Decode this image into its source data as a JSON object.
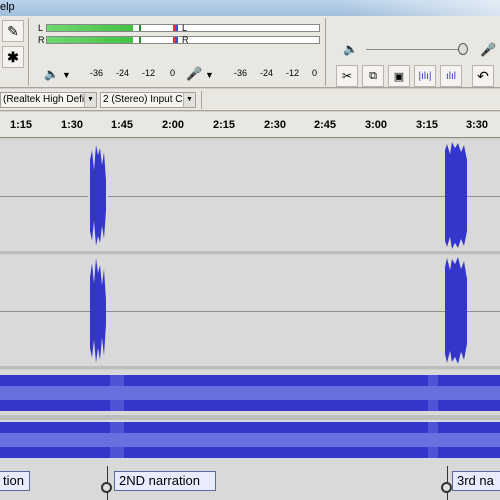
{
  "menu": {
    "partial_help": "elp"
  },
  "colors": {
    "waveform": "#3436cb",
    "waveform_light": "#6a6fe0",
    "track_bg": "#d9d9d9",
    "meter_green": "#44c244"
  },
  "meters": {
    "play_ticks": [
      "-36",
      "-24",
      "-12",
      "0"
    ],
    "rec_ticks": [
      "-36",
      "-24",
      "-12",
      "0"
    ],
    "left_channel": "L",
    "right_channel": "R"
  },
  "toolbar_icons": {
    "pencil": "pencil-icon",
    "multi": "multi-tool-icon",
    "speaker": "speaker-icon",
    "mic": "microphone-icon",
    "trim": "trim-icon",
    "silence": "silence-icon",
    "undo": "undo-icon"
  },
  "device": {
    "output_device": "(Realtek High Defi",
    "input_channels": "2 (Stereo) Input C"
  },
  "ruler": {
    "labels": [
      "1:15",
      "1:30",
      "1:45",
      "2:00",
      "2:15",
      "2:30",
      "2:45",
      "3:00",
      "3:15",
      "3:30"
    ]
  },
  "labels": {
    "first": "tion",
    "second": "2ND narration",
    "third": "3rd na"
  }
}
